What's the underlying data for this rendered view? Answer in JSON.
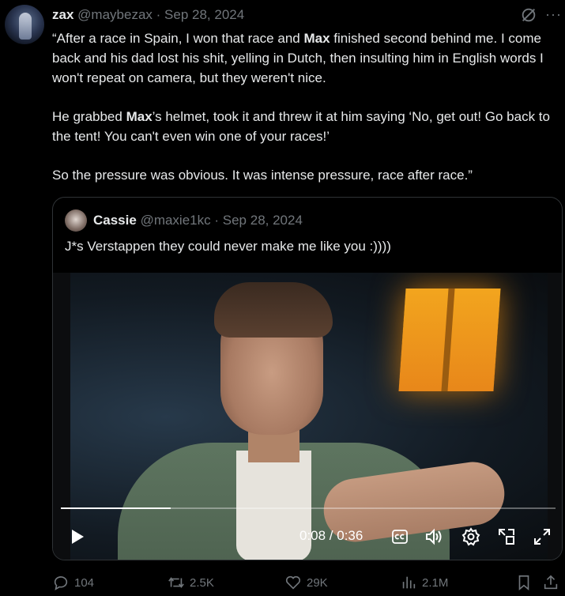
{
  "tweet": {
    "author_name": "zax",
    "author_handle": "@maybezax",
    "separator": "·",
    "date": "Sep 28, 2024",
    "text": {
      "p1_a": "“After a race in Spain, I won that race and ",
      "p1_bold": "Max",
      "p1_b": " finished second behind me. I come back and his dad lost his shit, yelling in Dutch, then insulting him in English words I won't repeat on camera, but they weren't nice.",
      "p2_a": "He grabbed ",
      "p2_bold": "Max",
      "p2_b": "’s helmet, took it and threw it at him saying ‘No, get out! Go back to the tent! You can't even win one of your races!’",
      "p3": "So the pressure was obvious. It was intense pressure, race after race.”"
    },
    "more_label": "···",
    "icons": [
      "grok-icon",
      "more-icon"
    ]
  },
  "quote": {
    "author_name": "Cassie",
    "author_handle": "@maxie1kc",
    "separator": "·",
    "date": "Sep 28, 2024",
    "text": "J*s Verstappen they could never make me like you :))))",
    "video": {
      "time": "0:08 / 0:36",
      "progress": 0.222,
      "icons": [
        "play-icon",
        "captions-icon",
        "volume-icon",
        "settings-icon",
        "pip-icon",
        "fullscreen-icon"
      ]
    }
  },
  "actions": {
    "replies": "104",
    "reposts": "2.5K",
    "likes": "29K",
    "views": "2.1M",
    "icons": [
      "reply-icon",
      "repost-icon",
      "like-icon",
      "views-icon",
      "bookmark-icon",
      "share-icon"
    ]
  }
}
